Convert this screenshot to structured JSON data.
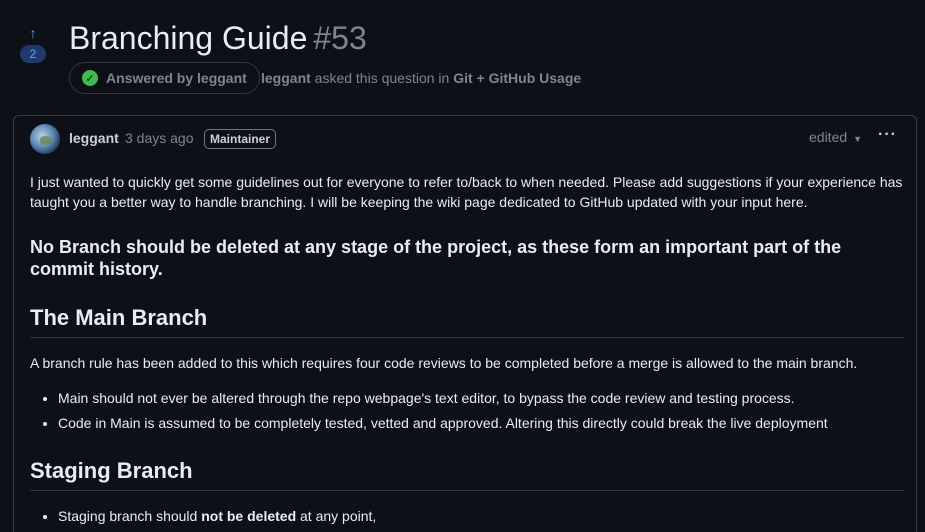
{
  "discussion": {
    "upvote_count": "2",
    "title": "Branching Guide",
    "number": "#53",
    "answered_label": "Answered by leggant",
    "asker": "leggant",
    "asked_text": "asked this question in",
    "category": "Git + GitHub Usage"
  },
  "post": {
    "author": "leggant",
    "time": "3 days ago",
    "role_badge": "Maintainer",
    "edited_label": "edited",
    "more_label": "···",
    "intro": "I just wanted to quickly get some guidelines out for everyone to refer to/back to when needed. Please add suggestions if your experience has taught you a better way to handle branching. I will be keeping the wiki page dedicated to GitHub updated with your input here.",
    "notice": "No Branch should be deleted at any stage of the project, as these form an important part of the commit history.",
    "main_heading": "The Main Branch",
    "main_desc": "A branch rule has been added to this which requires four code reviews to be completed before a merge is allowed to the main branch.",
    "main_bullets": [
      "Main should not ever be altered through the repo webpage's text editor, to bypass the code review and testing process.",
      "Code in Main is assumed to be completely tested, vetted and approved. Altering this directly could break the live deployment"
    ],
    "staging_heading": "Staging Branch",
    "staging_bullet_pre": "Staging branch should",
    "staging_bullet_bold": "not be deleted",
    "staging_bullet_post": "at any point,"
  },
  "colors": {
    "accent": "#58a6ff",
    "success": "#3fb950",
    "background": "#0d1117"
  },
  "icons": {
    "upvote": "arrow-up-icon",
    "answered": "check-circle-icon",
    "edited": "chevron-down-icon",
    "more": "kebab-horizontal-icon"
  }
}
